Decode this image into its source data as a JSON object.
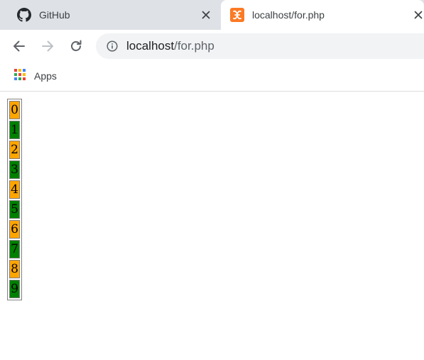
{
  "tabs": [
    {
      "title": "GitHub",
      "icon": "github-icon",
      "active": false
    },
    {
      "title": "localhost/for.php",
      "icon": "xampp-icon",
      "active": true
    }
  ],
  "toolbar": {
    "back_icon": "back-arrow-icon",
    "forward_icon": "forward-arrow-icon",
    "reload_icon": "reload-icon",
    "url_host": "localhost",
    "url_path": "/for.php",
    "info_icon": "info-icon"
  },
  "bookmarks": {
    "apps_label": "Apps",
    "apps_icon": "apps-grid-icon"
  },
  "page": {
    "rows": [
      "0",
      "1",
      "2",
      "3",
      "4",
      "5",
      "6",
      "7",
      "8",
      "9"
    ],
    "even_color": "#ffa500",
    "odd_color": "#008000"
  },
  "colors": {
    "tabstrip": "#dee1e6",
    "omnibox": "#f1f3f4",
    "xampp_orange": "#fb7a24"
  }
}
